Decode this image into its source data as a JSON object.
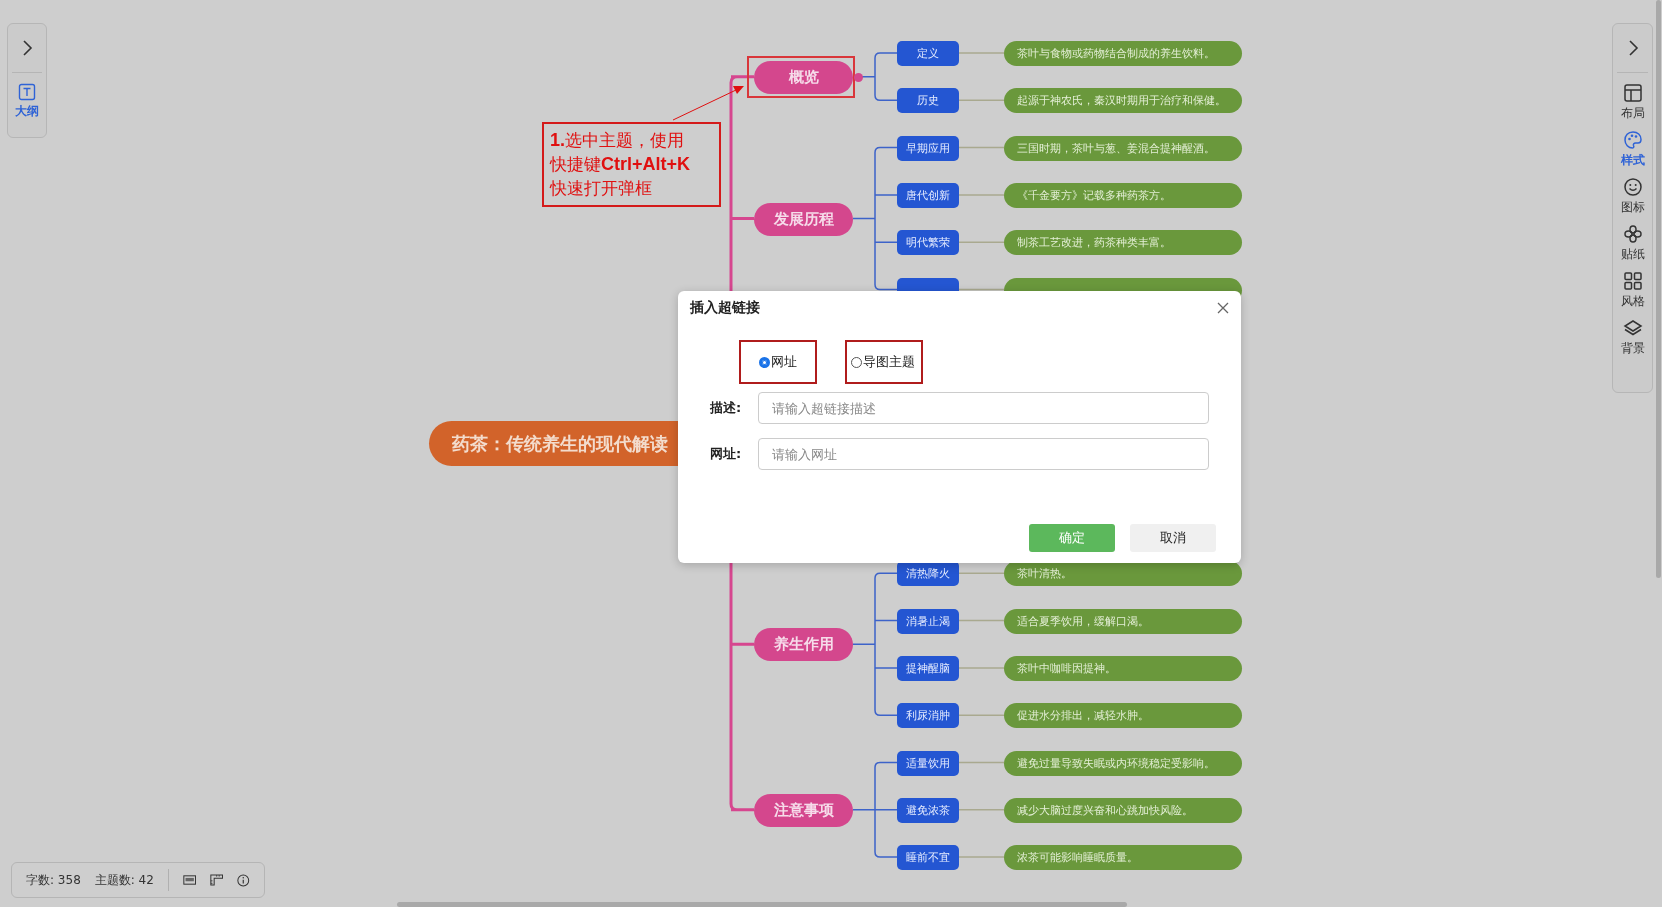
{
  "left_panel": {
    "items": [
      {
        "label": "大纲",
        "selected": true
      }
    ]
  },
  "right_panel": {
    "items": [
      {
        "label": "布局",
        "selected": false
      },
      {
        "label": "样式",
        "selected": true
      },
      {
        "label": "图标",
        "selected": false
      },
      {
        "label": "贴纸",
        "selected": false
      },
      {
        "label": "风格",
        "selected": false
      },
      {
        "label": "背景",
        "selected": false
      }
    ]
  },
  "mindmap": {
    "root": "药茶：传统养生的现代解读",
    "branches": [
      {
        "label": "概览",
        "selected": true,
        "children": [
          {
            "label": "定义",
            "detail": "茶叶与食物或药物结合制成的养生饮料。"
          },
          {
            "label": "历史",
            "detail": "起源于神农氏，秦汉时期用于治疗和保健。"
          }
        ]
      },
      {
        "label": "发展历程",
        "selected": false,
        "children": [
          {
            "label": "早期应用",
            "detail": "三国时期，茶叶与葱、姜混合提神醒酒。"
          },
          {
            "label": "唐代创新",
            "detail": "《千金要方》记载多种药茶方。"
          },
          {
            "label": "明代繁荣",
            "detail": "制茶工艺改进，药茶种类丰富。"
          }
        ]
      },
      {
        "label": "养生作用",
        "selected": false,
        "children": [
          {
            "label": "清热降火",
            "detail": "茶叶清热。"
          },
          {
            "label": "消暑止渴",
            "detail": "适合夏季饮用，缓解口渴。"
          },
          {
            "label": "提神醒脑",
            "detail": "茶叶中咖啡因提神。"
          },
          {
            "label": "利尿消肿",
            "detail": "促进水分排出，减轻水肿。"
          }
        ]
      },
      {
        "label": "注意事项",
        "selected": false,
        "children": [
          {
            "label": "适量饮用",
            "detail": "避免过量导致失眠或内环境稳定受影响。"
          },
          {
            "label": "避免浓茶",
            "detail": "减少大脑过度兴奋和心跳加快风险。"
          },
          {
            "label": "睡前不宜",
            "detail": "浓茶可能影响睡眠质量。"
          }
        ]
      }
    ]
  },
  "annotation": {
    "text": "**1.**选中主题，使用快捷键**Ctrl+Alt+K**快速打开弹框"
  },
  "dialog": {
    "title": "插入超链接",
    "link_types": [
      {
        "label": "网址",
        "selected": true
      },
      {
        "label": "导图主题",
        "selected": false
      }
    ],
    "fields": [
      {
        "label": "描述:",
        "placeholder": "请输入超链接描述"
      },
      {
        "label": "网址:",
        "placeholder": "请输入网址"
      }
    ],
    "buttons": [
      {
        "label": "确定",
        "kind": "primary"
      },
      {
        "label": "取消",
        "kind": "secondary"
      }
    ]
  },
  "status_bar": {
    "word_count": "字数: 358",
    "topic_count": "主题数: 42"
  }
}
